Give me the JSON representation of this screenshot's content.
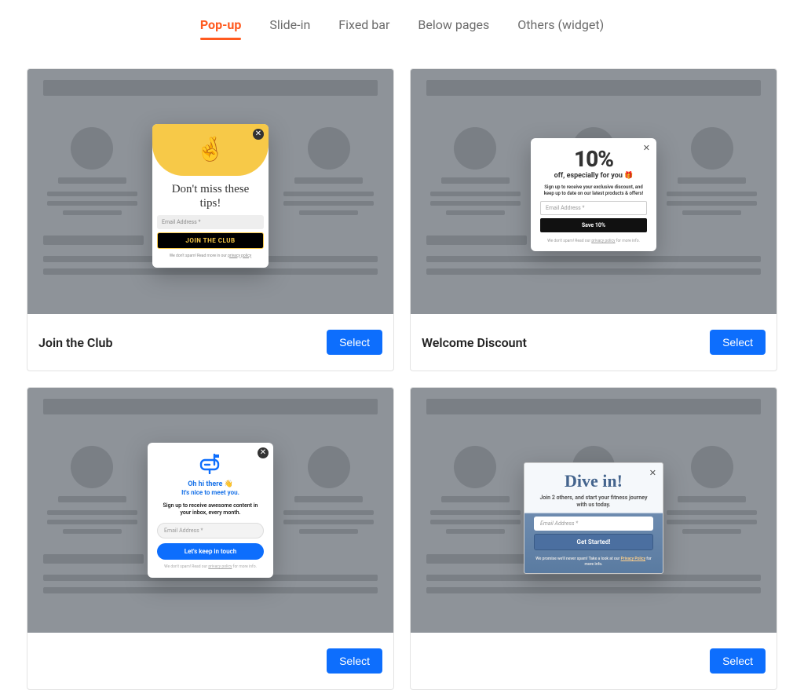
{
  "tabs": [
    {
      "label": "Pop-up",
      "active": true
    },
    {
      "label": "Slide-in",
      "active": false
    },
    {
      "label": "Fixed bar",
      "active": false
    },
    {
      "label": "Below pages",
      "active": false
    },
    {
      "label": "Others (widget)",
      "active": false
    }
  ],
  "select_label": "Select",
  "templates": [
    {
      "title": "Join the Club",
      "popup": {
        "emoji": "🤞",
        "heading": "Don't miss these tips!",
        "email_placeholder": "Email Address *",
        "button": "JOIN THE CLUB",
        "fineprint_prefix": "We don't spam! Read more in our ",
        "fineprint_link": "privacy policy"
      }
    },
    {
      "title": "Welcome Discount",
      "popup": {
        "percent": "10%",
        "subline": "off, especially for you 🎁",
        "desc": "Sign up to receive your exclusive discount, and keep up to date on our latest products & offers!",
        "email_placeholder": "Email Address *",
        "button": "Save 10%",
        "fineprint_prefix": "We don't spam! Read our ",
        "fineprint_link": "privacy policy",
        "fineprint_suffix": " for more info."
      }
    },
    {
      "title": "",
      "popup": {
        "line1": "Oh hi there 👋",
        "line2": "It's nice to meet you.",
        "desc": "Sign up to receive awesome content in your inbox, every month.",
        "email_placeholder": "Email Address *",
        "button": "Let's keep in touch",
        "fineprint_prefix": "We don't spam! Read our ",
        "fineprint_link": "privacy policy",
        "fineprint_suffix": " for more info."
      }
    },
    {
      "title": "",
      "popup": {
        "heading": "Dive in!",
        "desc": "Join 2 others, and start your fitness journey with us today.",
        "email_placeholder": "Email Address *",
        "button": "Get Started!",
        "fineprint_prefix": "We promise we'll never spam! Take a look at our ",
        "fineprint_link": "Privacy Policy",
        "fineprint_suffix": " for more info."
      }
    }
  ]
}
